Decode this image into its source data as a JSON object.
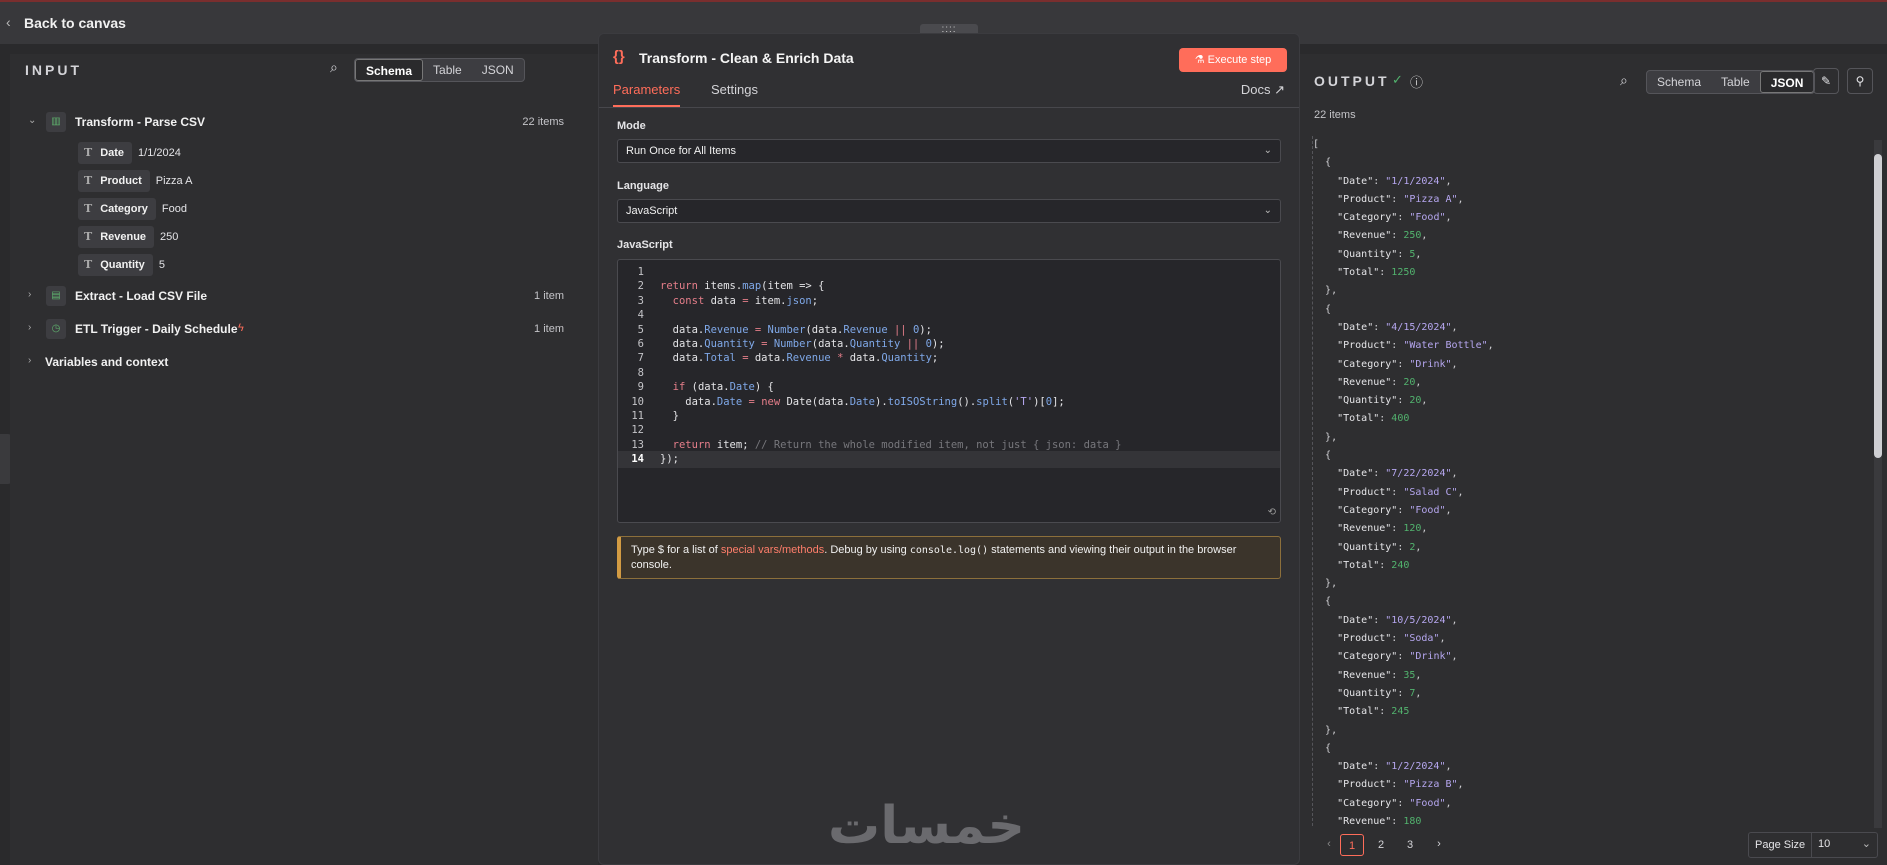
{
  "topbar": {
    "back_label": "Back to canvas",
    "drag_handle": "::::"
  },
  "input": {
    "title": "INPUT",
    "views": [
      "Schema",
      "Table",
      "JSON"
    ],
    "active_view": "Schema",
    "nodes": [
      {
        "name": "Transform - Parse CSV",
        "count": "22 items",
        "expanded": true,
        "fields": [
          {
            "name": "Date",
            "value": "1/1/2024"
          },
          {
            "name": "Product",
            "value": "Pizza A"
          },
          {
            "name": "Category",
            "value": "Food"
          },
          {
            "name": "Revenue",
            "value": "250"
          },
          {
            "name": "Quantity",
            "value": "5"
          }
        ]
      },
      {
        "name": "Extract - Load CSV File",
        "count": "1 item"
      },
      {
        "name": "ETL Trigger - Daily Schedule",
        "count": "1 item"
      }
    ],
    "variables_label": "Variables and context"
  },
  "modal": {
    "title": "Transform - Clean & Enrich Data",
    "execute_label": "Execute step",
    "tabs": [
      "Parameters",
      "Settings"
    ],
    "docs_label": "Docs",
    "mode_label": "Mode",
    "mode_value": "Run Once for All Items",
    "language_label": "Language",
    "language_value": "JavaScript",
    "code_label": "JavaScript",
    "code_lines": [
      "",
      "return items.map(item => {",
      "  const data = item.json;",
      "",
      "  data.Revenue = Number(data.Revenue || 0);",
      "  data.Quantity = Number(data.Quantity || 0);",
      "  data.Total = data.Revenue * data.Quantity;",
      "",
      "  if (data.Date) {",
      "    data.Date = new Date(data.Date).toISOString().split('T')[0];",
      "  }",
      "",
      "  return item; // Return the whole modified item, not just { json: data }",
      "});"
    ],
    "hint": {
      "pre": "Type $ for a list of ",
      "link": "special vars/methods",
      "mid": ". Debug by using ",
      "code": "console.log()",
      "post": " statements and viewing their output in the browser console."
    }
  },
  "output": {
    "title": "OUTPUT",
    "count": "22 items",
    "views": [
      "Schema",
      "Table",
      "JSON"
    ],
    "active_view": "JSON",
    "records": [
      {
        "Date": "1/1/2024",
        "Product": "Pizza A",
        "Category": "Food",
        "Revenue": 250,
        "Quantity": 5,
        "Total": 1250
      },
      {
        "Date": "4/15/2024",
        "Product": "Water Bottle",
        "Category": "Drink",
        "Revenue": 20,
        "Quantity": 20,
        "Total": 400
      },
      {
        "Date": "7/22/2024",
        "Product": "Salad C",
        "Category": "Food",
        "Revenue": 120,
        "Quantity": 2,
        "Total": 240
      },
      {
        "Date": "10/5/2024",
        "Product": "Soda",
        "Category": "Drink",
        "Revenue": 35,
        "Quantity": 7,
        "Total": 245
      },
      {
        "Date": "1/2/2024",
        "Product": "Pizza B",
        "Category": "Food",
        "Revenue": 180
      }
    ],
    "pages": [
      "1",
      "2",
      "3"
    ],
    "current_page": "1",
    "page_size_label": "Page Size",
    "page_size_value": "10"
  },
  "watermark": "خمسات"
}
